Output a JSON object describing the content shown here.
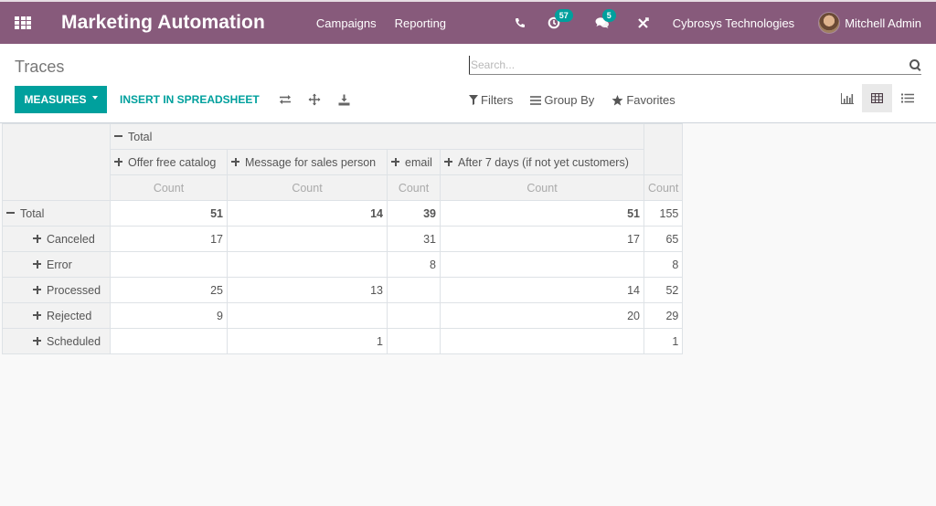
{
  "navbar": {
    "app_title": "Marketing Automation",
    "menu": [
      {
        "label": "Campaigns"
      },
      {
        "label": "Reporting"
      }
    ],
    "systray": {
      "activities_count": "57",
      "messages_count": "5",
      "company": "Cybrosys Technologies",
      "user": "Mitchell Admin"
    },
    "bg_color": "#875a7b",
    "badge_color": "#00a09d"
  },
  "control_panel": {
    "breadcrumb": "Traces",
    "search": {
      "placeholder": "Search...",
      "value": ""
    },
    "measures_label": "MEASURES",
    "insert_spreadsheet_label": "INSERT IN SPREADSHEET",
    "filters_label": "Filters",
    "groupby_label": "Group By",
    "favorites_label": "Favorites",
    "views": [
      "graph",
      "pivot",
      "list"
    ],
    "active_view": "pivot",
    "accent_color": "#00a09d"
  },
  "pivot": {
    "col_group_header": "Total",
    "columns": [
      {
        "label": "Offer free catalog"
      },
      {
        "label": "Message for sales person"
      },
      {
        "label": "email"
      },
      {
        "label": "After 7 days (if not yet customers)"
      }
    ],
    "measure": "Count",
    "total_row": {
      "label": "Total",
      "values": [
        "51",
        "14",
        "39",
        "51"
      ],
      "total": "155"
    },
    "rows": [
      {
        "label": "Canceled",
        "values": [
          "17",
          "",
          "31",
          "17"
        ],
        "total": "65"
      },
      {
        "label": "Error",
        "values": [
          "",
          "",
          "8",
          ""
        ],
        "total": "8"
      },
      {
        "label": "Processed",
        "values": [
          "25",
          "13",
          "",
          "14"
        ],
        "total": "52"
      },
      {
        "label": "Rejected",
        "values": [
          "9",
          "",
          "",
          "20"
        ],
        "total": "29"
      },
      {
        "label": "Scheduled",
        "values": [
          "",
          "1",
          "",
          ""
        ],
        "total": "1"
      }
    ]
  }
}
